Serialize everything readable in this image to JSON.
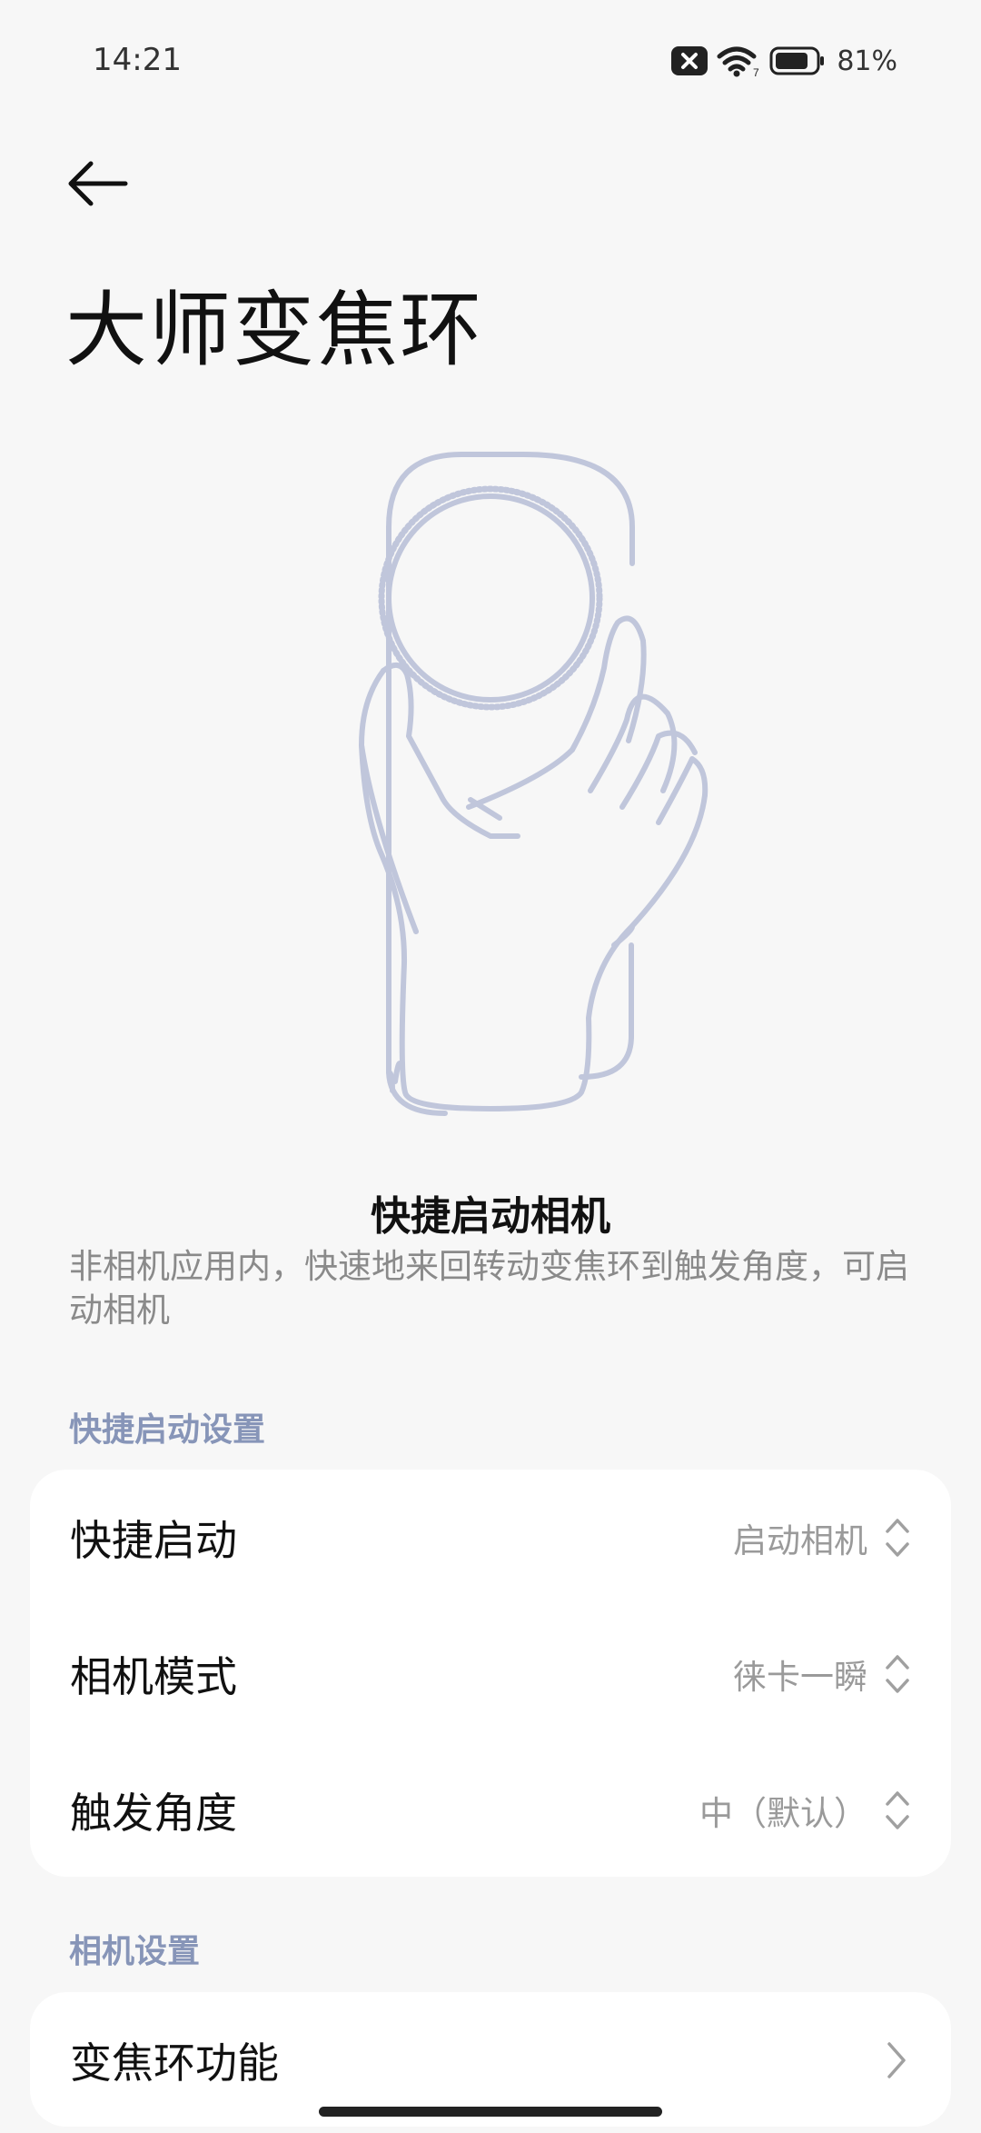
{
  "status_bar": {
    "time": "14:21",
    "battery_percent": "81%",
    "wifi_band": "7"
  },
  "header": {
    "back_icon": "arrow-left-icon",
    "title": "大师变焦环"
  },
  "feature": {
    "title": "快捷启动相机",
    "description": "非相机应用内，快速地来回转动变焦环到触发角度，可启动相机"
  },
  "sections": {
    "quick_launch": {
      "label": "快捷启动设置",
      "rows": [
        {
          "label": "快捷启动",
          "value": "启动相机"
        },
        {
          "label": "相机模式",
          "value": "徕卡一瞬"
        },
        {
          "label": "触发角度",
          "value": "中（默认）"
        }
      ]
    },
    "camera": {
      "label": "相机设置",
      "rows": [
        {
          "label": "变焦环功能"
        }
      ]
    }
  },
  "colors": {
    "accent_label": "#8795b8",
    "illustration": "#c0c6db",
    "background": "#f7f7f7",
    "card": "#ffffff"
  }
}
